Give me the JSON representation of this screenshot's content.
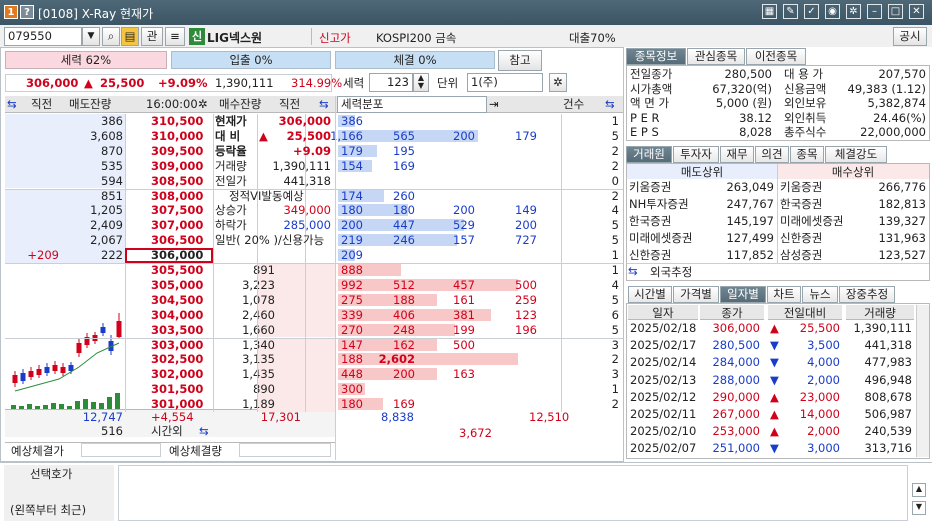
{
  "window": {
    "badge1": "1",
    "badge2": "?",
    "title": "[0108] X-Ray 현재가",
    "icons": [
      "grid-icon",
      "edit-icon",
      "check-icon",
      "camera-icon",
      "gear-icon",
      "minimize-icon",
      "maximize-icon",
      "close-icon"
    ]
  },
  "toolbar": {
    "code": "079550",
    "btn_gwan": "관",
    "sin_badge": "신",
    "stock_name": "LIG넥스원",
    "new_high": "신고가",
    "index_label": "KOSPI200 금속",
    "loan": "대출70%",
    "notice": "공시"
  },
  "status": {
    "power": "세력 62%",
    "inflow": "입출 0%",
    "exec": "체결 0%",
    "ref": "참고"
  },
  "price_summary": {
    "price": "306,000",
    "arrow": "▲",
    "change": "25,500",
    "rate": "+9.09%",
    "volume": "1,390,111",
    "vol_ratio": "314.99%"
  },
  "force_ctrl": {
    "label": "세력",
    "value": "123",
    "unit_label": "단위",
    "unit_value": "1(주)"
  },
  "orderbook": {
    "headers": {
      "prev1": "직전",
      "sell_qty": "매도잔량",
      "time": "16:00:00",
      "buy_qty": "매수잔량",
      "prev2": "직전",
      "force_dist": "세력분포",
      "count": "건수"
    },
    "asks": [
      {
        "qty": "386",
        "price": "310,500",
        "force": [
          "386",
          "",
          "",
          ""
        ],
        "cnt": "1",
        "bar": 0.12
      },
      {
        "qty": "3,608",
        "price": "310,000",
        "force": [
          "1,166",
          "565",
          "200",
          "179"
        ],
        "cnt": "5",
        "bar": 1.0
      },
      {
        "qty": "870",
        "price": "309,500",
        "force": [
          "179",
          "195",
          "",
          ""
        ],
        "cnt": "2",
        "bar": 0.28
      },
      {
        "qty": "535",
        "price": "309,000",
        "force": [
          "154",
          "169",
          "",
          ""
        ],
        "cnt": "2",
        "bar": 0.24
      },
      {
        "qty": "594",
        "price": "308,500",
        "force": [
          "",
          "",
          "",
          ""
        ],
        "cnt": "0",
        "bar": 0
      },
      {
        "qty": "851",
        "price": "308,000",
        "force": [
          "174",
          "260",
          "",
          ""
        ],
        "cnt": "2",
        "bar": 0.33
      },
      {
        "qty": "1,205",
        "price": "307,500",
        "force": [
          "180",
          "180",
          "200",
          "149"
        ],
        "cnt": "4",
        "bar": 0.5
      },
      {
        "qty": "2,409",
        "price": "307,000",
        "force": [
          "200",
          "447",
          "529",
          "200"
        ],
        "cnt": "5",
        "bar": 0.9
      },
      {
        "qty": "2,067",
        "price": "306,500",
        "force": [
          "219",
          "246",
          "157",
          "727"
        ],
        "cnt": "5",
        "bar": 0.85
      },
      {
        "qty": "222",
        "price": "306,000",
        "prev": "+209",
        "force": [
          "209",
          "",
          "",
          ""
        ],
        "cnt": "1",
        "bar": 0.12
      }
    ],
    "bids": [
      {
        "qty": "891",
        "price": "305,500",
        "force": [
          "888",
          "",
          "",
          ""
        ],
        "cnt": "1",
        "bar": 0.35
      },
      {
        "qty": "3,223",
        "price": "305,000",
        "force": [
          "992",
          "512",
          "457",
          "500"
        ],
        "cnt": "4",
        "bar": 1.0
      },
      {
        "qty": "1,078",
        "price": "304,500",
        "force": [
          "275",
          "188",
          "161",
          "259"
        ],
        "cnt": "5",
        "bar": 0.55
      },
      {
        "qty": "2,460",
        "price": "304,000",
        "force": [
          "339",
          "406",
          "381",
          "123"
        ],
        "cnt": "6",
        "bar": 0.85
      },
      {
        "qty": "1,660",
        "price": "303,500",
        "force": [
          "270",
          "248",
          "199",
          "196"
        ],
        "cnt": "5",
        "bar": 0.65
      },
      {
        "qty": "1,340",
        "price": "303,000",
        "force": [
          "147",
          "162",
          "500",
          ""
        ],
        "cnt": "3",
        "bar": 0.55
      },
      {
        "qty": "3,135",
        "price": "302,500",
        "force": [
          "188",
          "2,602",
          "",
          ""
        ],
        "cnt": "2",
        "bar": 1.0
      },
      {
        "qty": "1,435",
        "price": "302,000",
        "force": [
          "448",
          "200",
          "163",
          ""
        ],
        "cnt": "3",
        "bar": 0.55
      },
      {
        "qty": "890",
        "price": "301,500",
        "force": [
          "300",
          "",
          "",
          ""
        ],
        "cnt": "1",
        "bar": 0.15
      },
      {
        "qty": "1,189",
        "price": "301,000",
        "force": [
          "180",
          "169",
          "",
          ""
        ],
        "cnt": "2",
        "bar": 0.25
      }
    ],
    "info": [
      {
        "k": "현재가",
        "v": "306,000"
      },
      {
        "k": "대 비",
        "a": "▲",
        "v": "25,500"
      },
      {
        "k": "등락율",
        "v": "+9.09"
      },
      {
        "k": "거래량",
        "v": "1,390,111"
      },
      {
        "k": "전일가",
        "v": "441,318"
      },
      {
        "k": "",
        "v": "정적VI발동예상"
      },
      {
        "k": "상승가",
        "v": "349,000"
      },
      {
        "k": "하락가",
        "v": "285,000"
      },
      {
        "k": "일반( 20% )/신용가능",
        "v": ""
      }
    ],
    "totals": {
      "sell_total": "12,747",
      "diff": "+4,554",
      "buy_total": "17,301",
      "after_hours_qty": "516",
      "after_hours": "시간외",
      "force_sell_total": "8,838",
      "force_buy_total": "12,510",
      "force_diff": "3,672"
    },
    "expected": {
      "exec_price": "예상체결가",
      "exec_qty": "예상체결량"
    }
  },
  "right": {
    "tabs1": [
      "종목정보",
      "관심종목",
      "이전종목"
    ],
    "info_left": [
      {
        "k": "전일종가",
        "v": "280,500"
      },
      {
        "k": "시가총액",
        "v": "67,320(억)"
      },
      {
        "k": "액 면 가",
        "v": "5,000 (원)"
      },
      {
        "k": "P E R",
        "v": "38.12"
      },
      {
        "k": "E P S",
        "v": "8,028"
      }
    ],
    "info_right": [
      {
        "k": "대 용 가",
        "v": "207,570"
      },
      {
        "k": "신용금액",
        "v": "49,383  (1.12)"
      },
      {
        "k": "외인보유",
        "v": "5,382,874"
      },
      {
        "k": "외인취득",
        "v": "24.46(%)"
      },
      {
        "k": "총주식수",
        "v": "22,000,000"
      }
    ],
    "tabs2": [
      "거래원",
      "투자자",
      "재무",
      "의견",
      "종목",
      "체결강도"
    ],
    "broker_head": {
      "sell": "매도상위",
      "buy": "매수상위"
    },
    "brokers": [
      {
        "sn": "키움증권",
        "sq": "263,049",
        "bn": "키움증권",
        "bq": "266,776"
      },
      {
        "sn": "NH투자증권",
        "sq": "247,767",
        "bn": "한국증권",
        "bq": "182,813"
      },
      {
        "sn": "한국증권",
        "sq": "145,197",
        "bn": "미래에셋증권",
        "bq": "139,327"
      },
      {
        "sn": "미래에셋증권",
        "sq": "127,499",
        "bn": "신한증권",
        "bq": "131,963"
      },
      {
        "sn": "신한증권",
        "sq": "117,852",
        "bn": "삼성증권",
        "bq": "123,527"
      }
    ],
    "foreign_est": "외국추정",
    "tabs3": [
      "시간별",
      "가격별",
      "일자별",
      "차트",
      "뉴스",
      "장중추정"
    ],
    "daily_head": [
      "일자",
      "종가",
      "전일대비",
      "거래량"
    ],
    "daily": [
      {
        "d": "2025/02/18",
        "c": "306,000",
        "dir": "up",
        "chg": "25,500",
        "v": "1,390,111"
      },
      {
        "d": "2025/02/17",
        "c": "280,500",
        "dir": "down",
        "chg": "3,500",
        "v": "441,318"
      },
      {
        "d": "2025/02/14",
        "c": "284,000",
        "dir": "down",
        "chg": "4,000",
        "v": "477,983"
      },
      {
        "d": "2025/02/13",
        "c": "288,000",
        "dir": "down",
        "chg": "2,000",
        "v": "496,948"
      },
      {
        "d": "2025/02/12",
        "c": "290,000",
        "dir": "up",
        "chg": "23,000",
        "v": "808,678"
      },
      {
        "d": "2025/02/11",
        "c": "267,000",
        "dir": "up",
        "chg": "14,000",
        "v": "506,987"
      },
      {
        "d": "2025/02/10",
        "c": "253,000",
        "dir": "up",
        "chg": "2,000",
        "v": "240,539"
      },
      {
        "d": "2025/02/07",
        "c": "251,000",
        "dir": "down",
        "chg": "3,000",
        "v": "313,716"
      }
    ]
  },
  "bottom": {
    "label1": "선택호가",
    "label2": "(왼쪽부터 최근)"
  },
  "colors": {
    "up": "#d0021b",
    "down": "#1a3cc8",
    "sell_bg": "#e8eefb",
    "buy_bg": "#fbe9e9"
  }
}
